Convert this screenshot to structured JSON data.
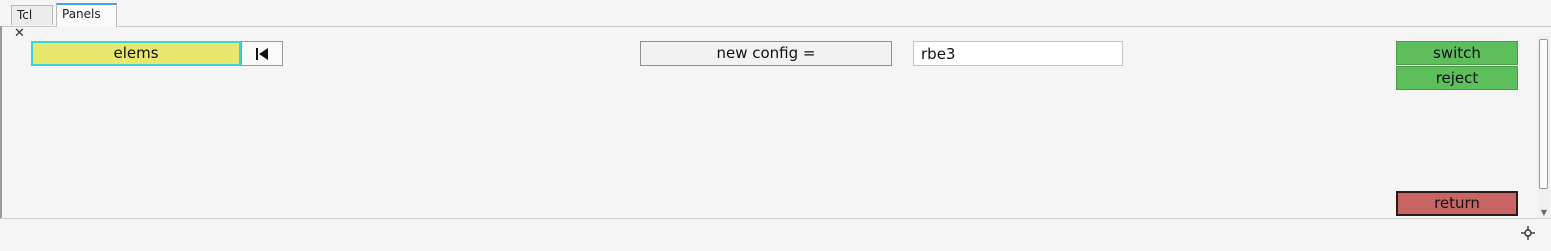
{
  "tabs": [
    {
      "label": "Tcl",
      "active": false
    },
    {
      "label": "Panels",
      "active": true
    }
  ],
  "panel": {
    "close_icon": "close-icon",
    "elems_button": "elems",
    "first_icon": "skip-to-first-icon",
    "config_label": "new config =",
    "config_value": "rbe3",
    "switch_button": "switch",
    "reject_button": "reject",
    "return_button": "return"
  },
  "colors": {
    "elems_bg": "#e8e86c",
    "elems_border": "#36d6d6",
    "green": "#5cbf5c",
    "return_red": "#c86464",
    "tab_accent": "#4aa3df"
  }
}
